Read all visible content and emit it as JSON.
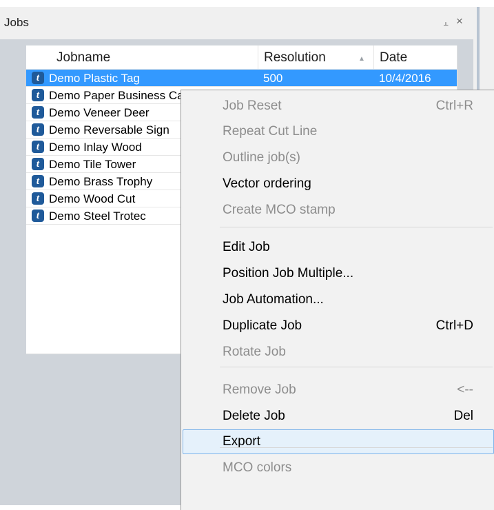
{
  "panel": {
    "title": "Jobs",
    "pin_glyph": "⫠",
    "close_glyph": "×"
  },
  "columns": {
    "jobname": "Jobname",
    "resolution": "Resolution",
    "date": "Date",
    "sort_indicator": "▲"
  },
  "jobs": [
    {
      "name": "Demo Plastic Tag",
      "resolution": "500",
      "date": "10/4/2016",
      "selected": true
    },
    {
      "name": "Demo Paper Business Card"
    },
    {
      "name": "Demo Veneer Deer"
    },
    {
      "name": "Demo Reversable Sign"
    },
    {
      "name": "Demo Inlay Wood"
    },
    {
      "name": "Demo Tile Tower"
    },
    {
      "name": "Demo Brass Trophy"
    },
    {
      "name": "Demo Wood Cut"
    },
    {
      "name": "Demo Steel Trotec"
    }
  ],
  "job_icon_glyph": "t",
  "icons": {
    "job": "trotec-t-icon",
    "pin": "pin-icon",
    "close": "close-icon",
    "sort": "sort-ascending-icon"
  },
  "context_menu": {
    "items": [
      {
        "label": "Job Reset",
        "shortcut": "Ctrl+R",
        "enabled": false
      },
      {
        "label": "Repeat Cut Line",
        "enabled": false
      },
      {
        "label": "Outline job(s)",
        "enabled": false
      },
      {
        "label": "Vector ordering",
        "enabled": true
      },
      {
        "label": "Create MCO stamp",
        "enabled": false
      },
      {
        "label": "Edit Job",
        "enabled": true
      },
      {
        "label": "Position Job Multiple...",
        "enabled": true
      },
      {
        "label": "Job Automation...",
        "enabled": true
      },
      {
        "label": "Duplicate Job",
        "shortcut": "Ctrl+D",
        "enabled": true
      },
      {
        "label": "Rotate Job",
        "enabled": false
      },
      {
        "label": "Remove Job",
        "shortcut": "<--",
        "enabled": false
      },
      {
        "label": "Delete Job",
        "shortcut": "Del",
        "enabled": true
      },
      {
        "label": "Export",
        "enabled": true,
        "highlighted": true
      },
      {
        "label": "MCO colors",
        "enabled": false
      }
    ]
  },
  "colors": {
    "selection": "#3399ff",
    "menu_highlight": "#e5f1fb",
    "disabled_text": "#8d8d8d",
    "job_icon": "#1f5a9a"
  }
}
